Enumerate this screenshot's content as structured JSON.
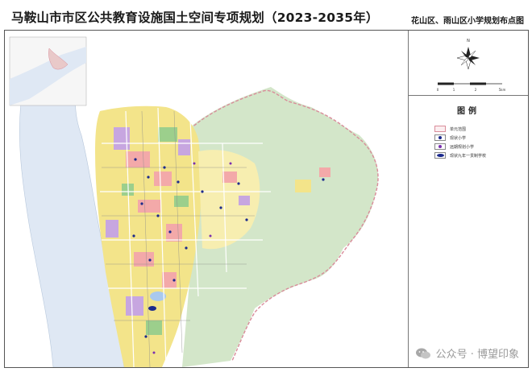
{
  "header": {
    "title": "马鞍山市市区公共教育设施国土空间专项规划（2023-2035年）",
    "subtitle": "花山区、雨山区小学规划布点图"
  },
  "compass": {
    "north_label": "N",
    "scale_labels": [
      "0",
      "1",
      "2",
      "5km"
    ]
  },
  "legend": {
    "title": "图例",
    "items": [
      {
        "label": "单元范围",
        "symbol": "boundary-line"
      },
      {
        "label": "现状小学",
        "symbol": "existing-school-dot"
      },
      {
        "label": "远期规划小学",
        "symbol": "planned-school-dot"
      },
      {
        "label": "现状九年一贯制学校",
        "symbol": "nine-year-school-oval"
      }
    ]
  },
  "colors": {
    "river": "#dfe8f4",
    "boundary": "#d98c9a",
    "greenland": "#d3e6c9",
    "residential": "#f3e48a",
    "commercial": "#f3a9a9",
    "industrial": "#c7a6e0",
    "school_marker": "#1c2a8c"
  },
  "watermark": {
    "text": "公众号 · 博望印象"
  }
}
